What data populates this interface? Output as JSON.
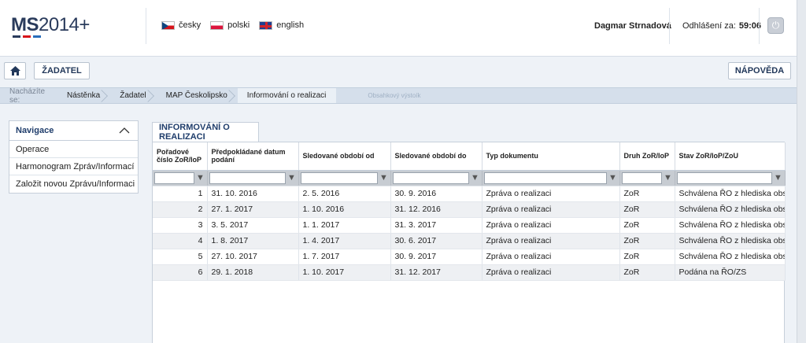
{
  "header": {
    "logo_main": "MS",
    "logo_year": "2014+",
    "logo_bar_colors": [
      "#2a3b5c",
      "#d7141a",
      "#2a6ebb"
    ],
    "languages": [
      {
        "flag": "cz",
        "label": "česky"
      },
      {
        "flag": "pl",
        "label": "polski"
      },
      {
        "flag": "en",
        "label": "english"
      }
    ],
    "user_name": "Dagmar Strnadová",
    "logout_label": "Odhlášení za:",
    "logout_timer": "59:06"
  },
  "toolbar": {
    "home_icon": "home-icon",
    "zadatel_label": "ŽADATEL",
    "napoveda_label": "NÁPOVĚDA"
  },
  "breadcrumb": {
    "label": "Nacházíte se:",
    "items": [
      "Nástěnka",
      "Žadatel",
      "MAP Českolipsko",
      "Informování o realizaci"
    ],
    "ghost": "Obsahkový výstoík"
  },
  "nav": {
    "title": "Navigace",
    "items": [
      "Operace",
      "Harmonogram Zpráv/Informací",
      "Založit novou Zprávu/Informaci"
    ]
  },
  "main": {
    "tab_label": "INFORMOVÁNÍ O REALIZACI",
    "columns": [
      "Pořadové číslo ZoR/IoP",
      "Předpokládané datum podání",
      "Sledované období od",
      "Sledované období do",
      "Typ dokumentu",
      "Druh ZoR/IoP",
      "Stav ZoR/IoP/ZoU"
    ],
    "rows": [
      [
        "1",
        "31. 10. 2016",
        "2. 5. 2016",
        "30. 9. 2016",
        "Zpráva o realizaci",
        "ZoR",
        "Schválena ŘO z hlediska obs..."
      ],
      [
        "2",
        "27. 1. 2017",
        "1. 10. 2016",
        "31. 12. 2016",
        "Zpráva o realizaci",
        "ZoR",
        "Schválena ŘO z hlediska obs..."
      ],
      [
        "3",
        "3. 5. 2017",
        "1. 1. 2017",
        "31. 3. 2017",
        "Zpráva o realizaci",
        "ZoR",
        "Schválena ŘO z hlediska obs..."
      ],
      [
        "4",
        "1. 8. 2017",
        "1. 4. 2017",
        "30. 6. 2017",
        "Zpráva o realizaci",
        "ZoR",
        "Schválena ŘO z hlediska obs..."
      ],
      [
        "5",
        "27. 10. 2017",
        "1. 7. 2017",
        "30. 9. 2017",
        "Zpráva o realizaci",
        "ZoR",
        "Schválena ŘO z hlediska obs..."
      ],
      [
        "6",
        "29. 1. 2018",
        "1. 10. 2017",
        "31. 12. 2017",
        "Zpráva o realizaci",
        "ZoR",
        "Podána na ŘO/ZS"
      ]
    ]
  }
}
